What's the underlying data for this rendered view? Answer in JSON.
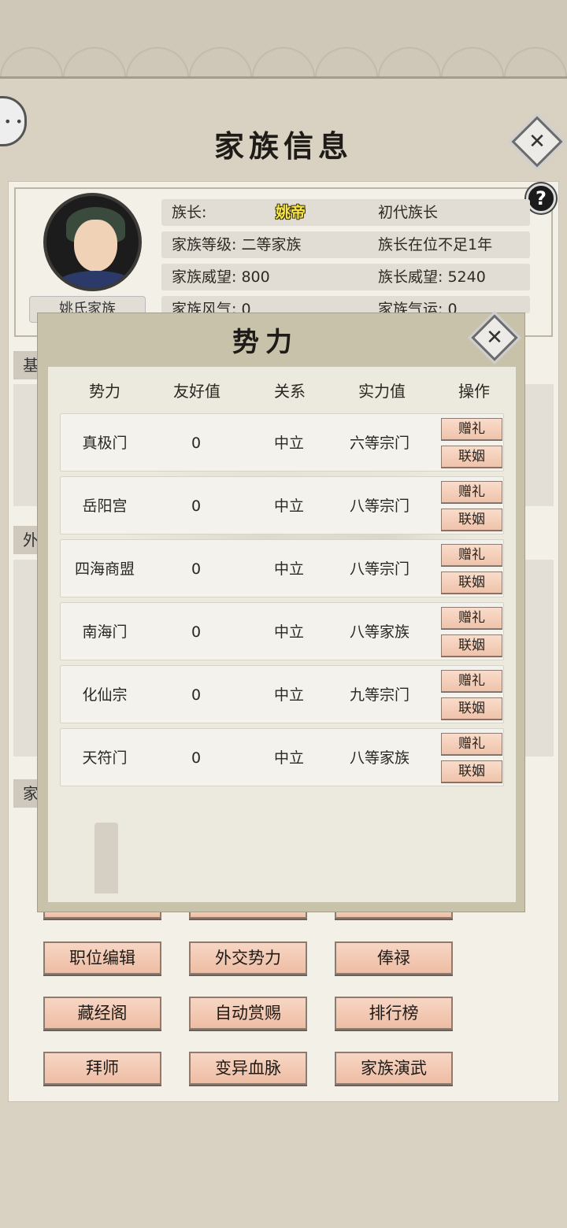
{
  "page": {
    "title": "家族信息",
    "close_icon": "✕",
    "help_icon": "?"
  },
  "family": {
    "name": "姚氏家族",
    "info": [
      {
        "left": "族长:",
        "right": "初代族长",
        "leader": "姚帝"
      },
      {
        "left": "家族等级: 二等家族",
        "right": "族长在位不足1年"
      },
      {
        "left": "家族威望: 800",
        "right": "族长威望: 5240"
      },
      {
        "left": "家族风气: 0",
        "right": "家族气运: 0"
      }
    ]
  },
  "sections": {
    "basic": "基",
    "diplomacy": "外",
    "family": "家"
  },
  "actions": [
    [
      "职位编辑",
      "外交势力",
      "俸禄"
    ],
    [
      "藏经阁",
      "自动赏赐",
      "排行榜"
    ],
    [
      "拜师",
      "变异血脉",
      "家族演武"
    ]
  ],
  "modal": {
    "title": "势力",
    "close_icon": "✕",
    "headers": [
      "势力",
      "友好值",
      "关系",
      "实力值",
      "操作"
    ],
    "gift_label": "赠礼",
    "marriage_label": "联姻",
    "rows": [
      {
        "name": "真极门",
        "friendship": "0",
        "relation": "中立",
        "strength": "六等宗门"
      },
      {
        "name": "岳阳宫",
        "friendship": "0",
        "relation": "中立",
        "strength": "八等宗门"
      },
      {
        "name": "四海商盟",
        "friendship": "0",
        "relation": "中立",
        "strength": "八等宗门"
      },
      {
        "name": "南海门",
        "friendship": "0",
        "relation": "中立",
        "strength": "八等家族"
      },
      {
        "name": "化仙宗",
        "friendship": "0",
        "relation": "中立",
        "strength": "九等宗门"
      },
      {
        "name": "天符门",
        "friendship": "0",
        "relation": "中立",
        "strength": "八等家族"
      }
    ]
  }
}
